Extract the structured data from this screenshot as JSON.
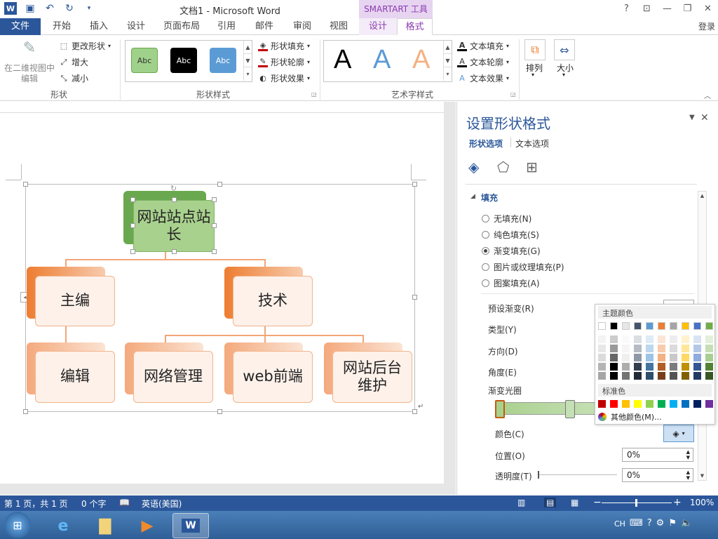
{
  "titlebar": {
    "doc_title": "文档1 - Microsoft Word",
    "context_tab": "SMARTART 工具",
    "help": "?"
  },
  "tabs": [
    "文件",
    "开始",
    "插入",
    "设计",
    "页面布局",
    "引用",
    "邮件",
    "审阅",
    "视图"
  ],
  "context_tabs": [
    "设计",
    "格式"
  ],
  "login": "登录",
  "ribbon": {
    "shape_group": {
      "edit_2d": "在二维视图中编辑",
      "change_shape": "更改形状",
      "larger": "增大",
      "smaller": "减小",
      "label": "形状"
    },
    "shape_styles": {
      "label": "形状样式",
      "fill": "形状填充",
      "outline": "形状轮廓",
      "effects": "形状效果",
      "samples": [
        "Abc",
        "Abc",
        "Abc"
      ]
    },
    "wordart": {
      "label": "艺术字样式",
      "text_fill": "文本填充",
      "text_outline": "文本轮廓",
      "text_effects": "文本效果",
      "samples": [
        "A",
        "A",
        "A"
      ]
    },
    "arrange": "排列",
    "size": "大小"
  },
  "smartart": {
    "root": "网站站点站长",
    "level2": [
      "主编",
      "技术"
    ],
    "level3": [
      "编辑",
      "网络管理",
      "web前端",
      "网站后台维护"
    ]
  },
  "pane": {
    "title": "设置形状格式",
    "tabs": [
      "形状选项",
      "文本选项"
    ],
    "section": "填充",
    "options": [
      "无填充(N)",
      "纯色填充(S)",
      "渐变填充(G)",
      "图片或纹理填充(P)",
      "图案填充(A)"
    ],
    "selected": "渐变填充(G)",
    "labels": {
      "preset": "预设渐变(R)",
      "type": "类型(Y)",
      "direction": "方向(D)",
      "angle": "角度(E)",
      "stops": "渐变光圈",
      "color": "颜色(C)",
      "position": "位置(O)",
      "transparency": "透明度(T)"
    },
    "position_value": "0%",
    "transparency_value": "0%"
  },
  "color_popup": {
    "theme_label": "主题颜色",
    "standard_label": "标准色",
    "more": "其他颜色(M)...",
    "theme_top": [
      "#ffffff",
      "#000000",
      "#e7e6e6",
      "#44546a",
      "#5b9bd5",
      "#ed7d31",
      "#a5a5a5",
      "#ffc000",
      "#4472c4",
      "#70ad47"
    ],
    "standard": [
      "#c00000",
      "#ff0000",
      "#ffc000",
      "#ffff00",
      "#92d050",
      "#00b050",
      "#00b0f0",
      "#0070c0",
      "#002060",
      "#7030a0"
    ]
  },
  "status": {
    "page": "第 1 页，共 1 页",
    "words": "0 个字",
    "lang": "英语(美国)",
    "zoom": "100%"
  },
  "taskbar": {
    "ime": "CH"
  }
}
